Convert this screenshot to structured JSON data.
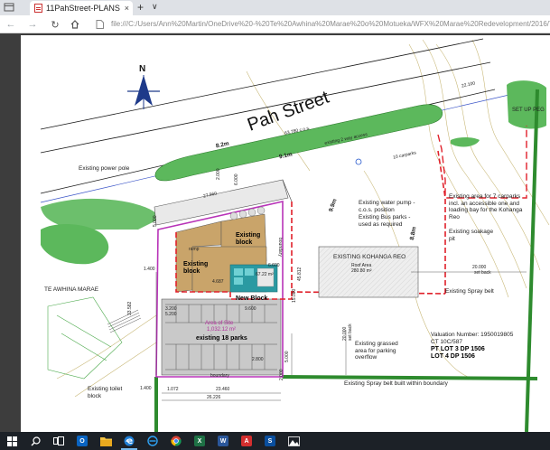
{
  "browser": {
    "tab_title": "11PahStreet-PLANS re",
    "tab_close": "×",
    "new_tab": "+",
    "tab_list": "∨",
    "url": "file:///C:/Users/Ann%20Martin/OneDrive%20-%20Te%20Awhina%20Marae%20o%20Motueka/WFX%20Marae%20Redevelopment/2016/ToSabe/11PahStreet"
  },
  "plan": {
    "street_name": "Pah Street",
    "north_letter": "N",
    "labels": {
      "existing_power_pole": "Existing power pole",
      "existing_block_1": "Existing block",
      "existing_block_2": "Existing block",
      "ramp": "ramp",
      "te_awhina_marae": "TE AWHINA MARAE",
      "new_block": "New Block",
      "area_of_site_title": "Area of Site",
      "area_of_site_value": "1,032.12 m²",
      "existing_18_parks": "existing 18 parks",
      "boundary_bottom": "boundary",
      "boundary_right": "boundary",
      "existing_toilet_block": "Existing toilet block",
      "existing_water_pump": "Existing water pump - c.o.s. position",
      "existing_bus_parks": "Existing Bus parks - used as required",
      "existing_kohanga_reo": "EXISTING KOHANGA REO",
      "roof_area": "Roof Area",
      "roof_area_value": "280.80 m²",
      "existing_grassed_area": "Existing grassed area for parking overflow",
      "valuation_number": "Valuation Number: 1950019805",
      "ct": "CT 10C/587",
      "pt_lot": "PT LOT 3 DP 1506",
      "lot4": "LOT 4 DP 1506",
      "area_for_7_carparks": "Existing area for 7 carparks incl. an accessible one and loading bay for the Kohanga Reo",
      "existing_soakage_pit": "Existing soakage pit",
      "existing_spray_belt": "Existing Spray belt",
      "existing_spray_belt_within": "Existing Spray belt built within boundary",
      "set_up_peg": "SET UP PEG",
      "kerb_pavement": "existing 2 way access",
      "ten_carparks": "10 carparks",
      "dim_22100": "22.100",
      "dim_63780": "63.780 c.o.s.",
      "dim_27960": "27.960",
      "dim_20000": "20.000",
      "dim_20000_setback": "set back",
      "dim_20000b": "20.000",
      "dim_20000b_sub": "set back",
      "dim_23460": "23.460",
      "dim_26226": "26.226",
      "dim_1072": "1.072",
      "dim_1400a": "1.400",
      "dim_1400b": "1.400",
      "dim_4687": "4.687",
      "dim_9600": "9.600",
      "dim_2800": "2.800",
      "dim_3200": "3.200",
      "dim_5200": "5.200",
      "dim_8m_a": "8.2m",
      "dim_8m_b": "9.1m",
      "dim_8m_c": "9.9m",
      "dim_8m_d": "8.8m",
      "dim_2000": "2.000",
      "dim_5000": "5.000",
      "dim_15000": "15.000",
      "dim_6600": "6.600",
      "dim_67m2": "67.22 m²",
      "dim_45812": "45.812",
      "dim_33582": "33.582",
      "dim_5000b": "5.000",
      "dim_2000b": "2.000",
      "dim_6000": "6.000"
    }
  },
  "taskbar": {
    "items": [
      "start",
      "search",
      "task-view",
      "outlook",
      "file-explorer",
      "edge",
      "chrome",
      "excel",
      "word",
      "acrobat",
      "powershell",
      "photos"
    ],
    "outlook_letter": "O",
    "excel_letter": "X",
    "word_letter": "W",
    "acrobat_letter": "A",
    "powershell_letter": "S"
  },
  "colors": {
    "boundary_pink": "#b833b8",
    "new_block_red": "#e0202a",
    "green_strip": "#3aa63a",
    "tab_bg": "#dee1e6",
    "taskbar_bg": "#1c2127"
  }
}
